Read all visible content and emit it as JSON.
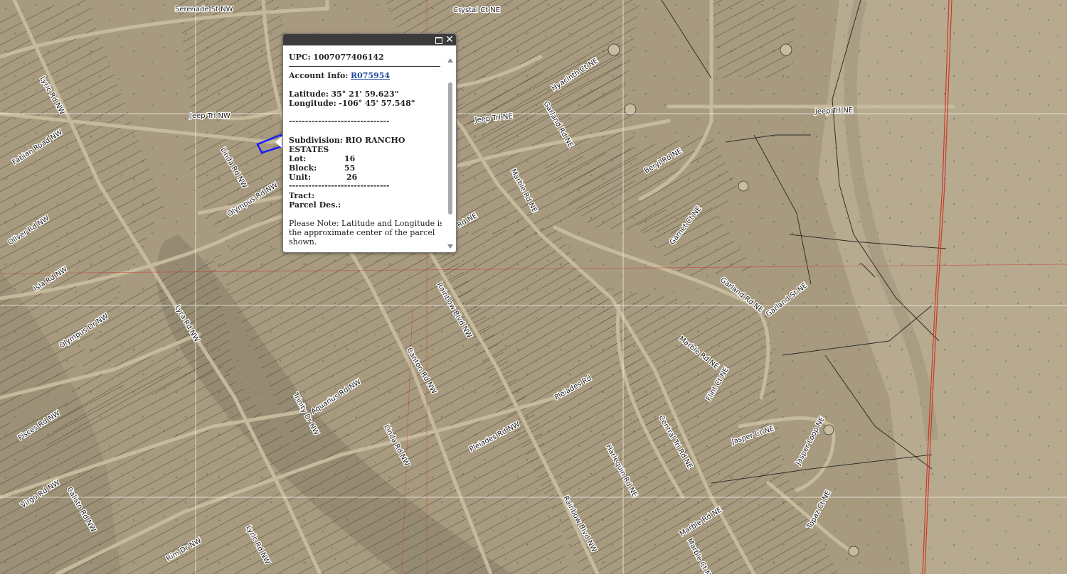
{
  "map": {
    "colors": {
      "terrain": "#a79a7f",
      "terrain_dark": "#8b8068",
      "terrain_light": "#b9ad93",
      "parcel_line": "#3a3a2c",
      "road": "#c8bc9f",
      "grid_line": "#f2f0ea",
      "boundary_red": "#c83a2a",
      "selected_parcel": "#1c1cff"
    },
    "road_labels": [
      "Serenade St NW",
      "Crystal Ct NE",
      "Jeep Trl NW",
      "Jeep Trl NE",
      "Jeep Trl NE",
      "Lyric Rd NW",
      "Fabian Road NW",
      "Linda Rd NW",
      "Olympus Rd NW",
      "Oliver Rd NW",
      "Isla Rd NW",
      "Hyacinth Ct NE",
      "Garland Rd NE",
      "Beryl Rd NE",
      "Marble Rd NE",
      "Beryl Rd NE",
      "Garnet Ct NE",
      "Garland Rd NE",
      "Garland St NE",
      "Rainbow Blvd NW",
      "Lyra Rd NW",
      "Olympus Dr NW",
      "Canton Rd NW",
      "Marble Rd NE",
      "Flint Ct NE",
      "Pleiades Rd",
      "Trinity Dr NW",
      "Aquarius Rd NW",
      "Pisces Rd NW",
      "Linda Rd NW",
      "Pleiades Rd NW",
      "Central Trl Rd NE",
      "Jasper Ct NE",
      "Jasper Loop NE",
      "Harlequin Rd NE",
      "Virgo Rd NW",
      "Calisto Rd NW",
      "Topaz Ct NE",
      "Marble Rd NE",
      "Rainbow Blvd NW",
      "Lyric Rd NW",
      "Rim Dr NW",
      "Marble Ct NE"
    ]
  },
  "popup": {
    "upc_label": "UPC:",
    "upc_value": "1007077406142",
    "account_label": "Account Info:",
    "account_value": "R075954",
    "latitude_label": "Latitude:",
    "latitude_value": "35° 21' 59.623\"",
    "longitude_label": "Longitude:",
    "longitude_value": "-106° 45' 57.548\"",
    "separator": "-------------------------------",
    "subdivision_label": "Subdivision:",
    "subdivision_value_1": "RIO RANCHO",
    "subdivision_value_2": "ESTATES",
    "lot_label": "Lot:",
    "lot_value": "16",
    "block_label": "Block:",
    "block_value": "55",
    "unit_label": "Unit:",
    "unit_value": "26",
    "tract_label": "Tract:",
    "parcel_des_label": "Parcel Des.:",
    "note_1": "Please Note: Latitude and Longitude is",
    "note_2": "the approximate center of the parcel",
    "note_3": "shown.",
    "maximize_icon": "maximize-icon",
    "close_icon": "close-icon",
    "close_glyph": "✕"
  }
}
